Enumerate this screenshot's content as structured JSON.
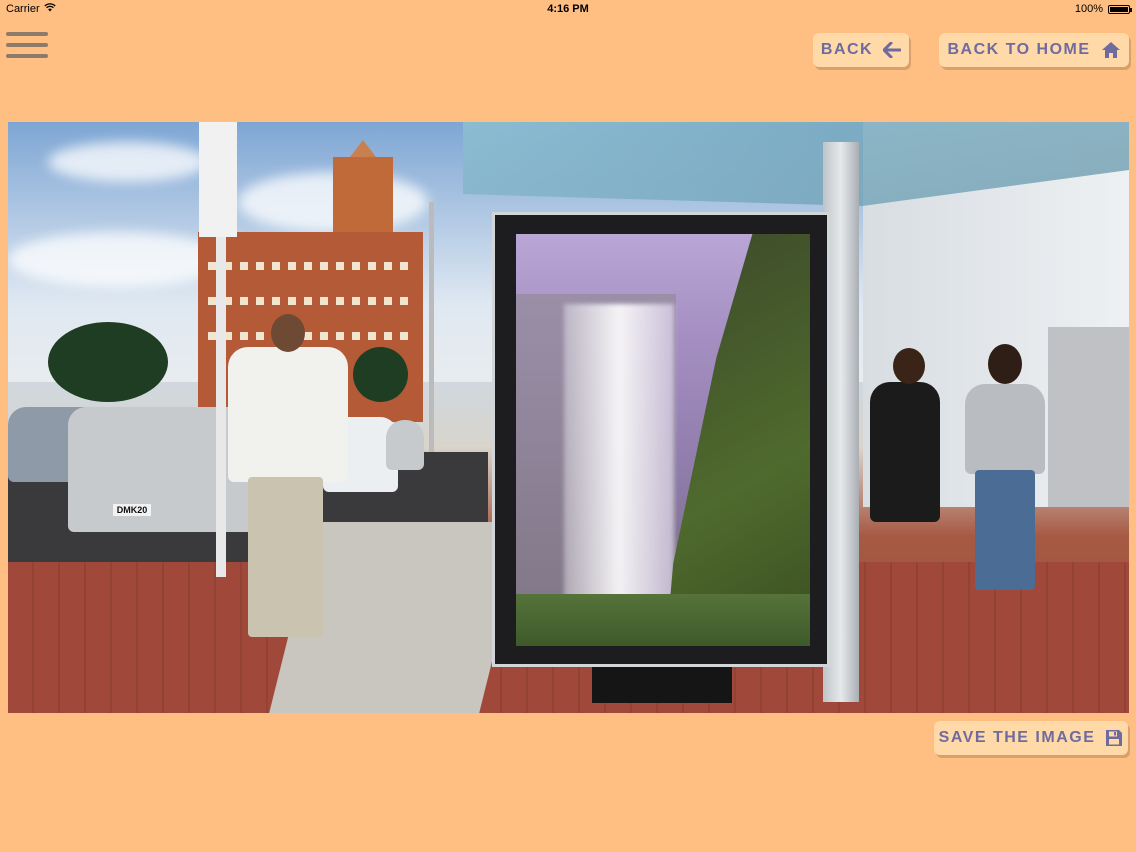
{
  "status_bar": {
    "carrier": "Carrier",
    "time": "4:16 PM",
    "battery": "100%",
    "battery_level": 1.0
  },
  "header": {
    "menu_icon": "hamburger-menu-icon",
    "back_label": "BACK",
    "back_icon": "arrow-left-icon",
    "home_label": "BACK TO HOME",
    "home_icon": "home-icon"
  },
  "footer": {
    "save_label": "SAVE THE IMAGE",
    "save_icon": "floppy-disk-icon"
  },
  "photo": {
    "plate_text": "DMK20"
  },
  "colors": {
    "background": "#ffbe82",
    "button_bg": "#ffd9a8",
    "button_text": "#6f6b9e",
    "menu_icon": "#8e7a6b"
  }
}
